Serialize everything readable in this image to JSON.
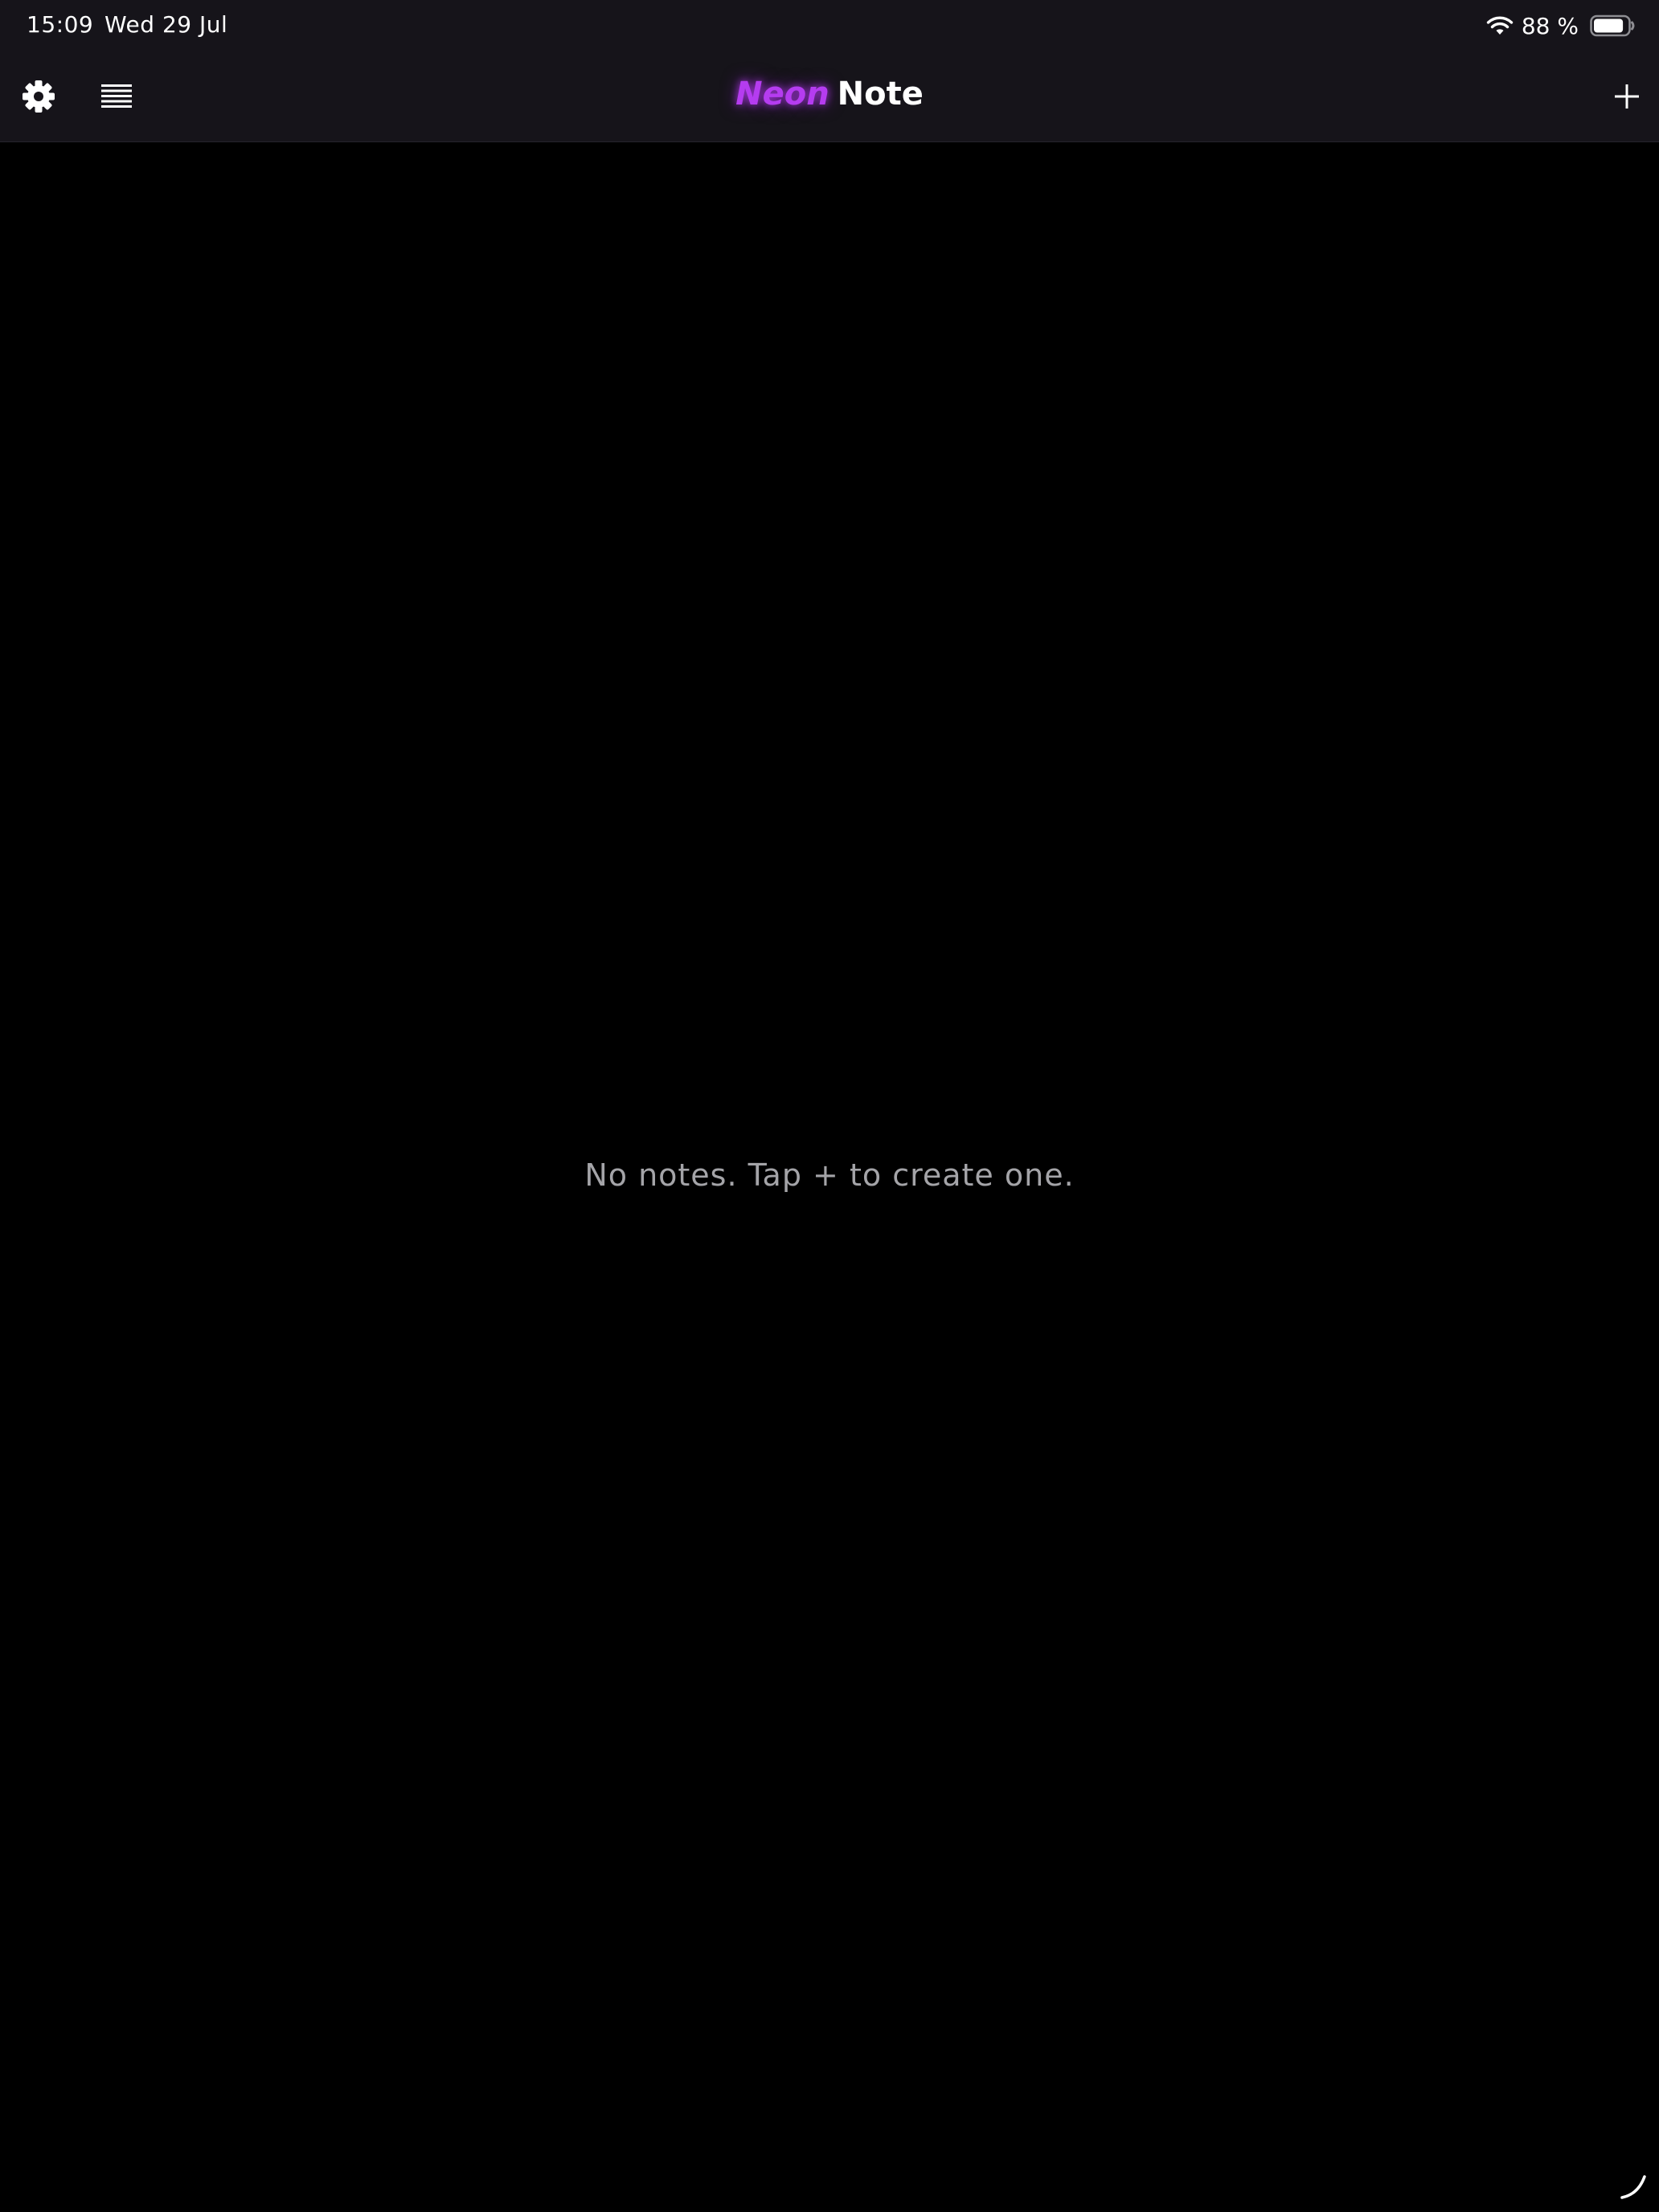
{
  "status_bar": {
    "time": "15:09",
    "date": "Wed 29 Jul",
    "battery_percent": "88 %",
    "battery_level": 0.88,
    "icons": [
      "wifi-icon",
      "battery-icon"
    ]
  },
  "nav": {
    "title_accent": "Neon",
    "title_main": "Note",
    "left_icons": [
      "gear-icon",
      "list-icon"
    ],
    "right_icons": [
      "plus-icon"
    ]
  },
  "main": {
    "empty_message": "No notes. Tap + to create one."
  },
  "colors": {
    "background": "#000000",
    "chrome": "#16141a",
    "accent": "#b53cf0",
    "muted_text": "#a4a4a8"
  }
}
